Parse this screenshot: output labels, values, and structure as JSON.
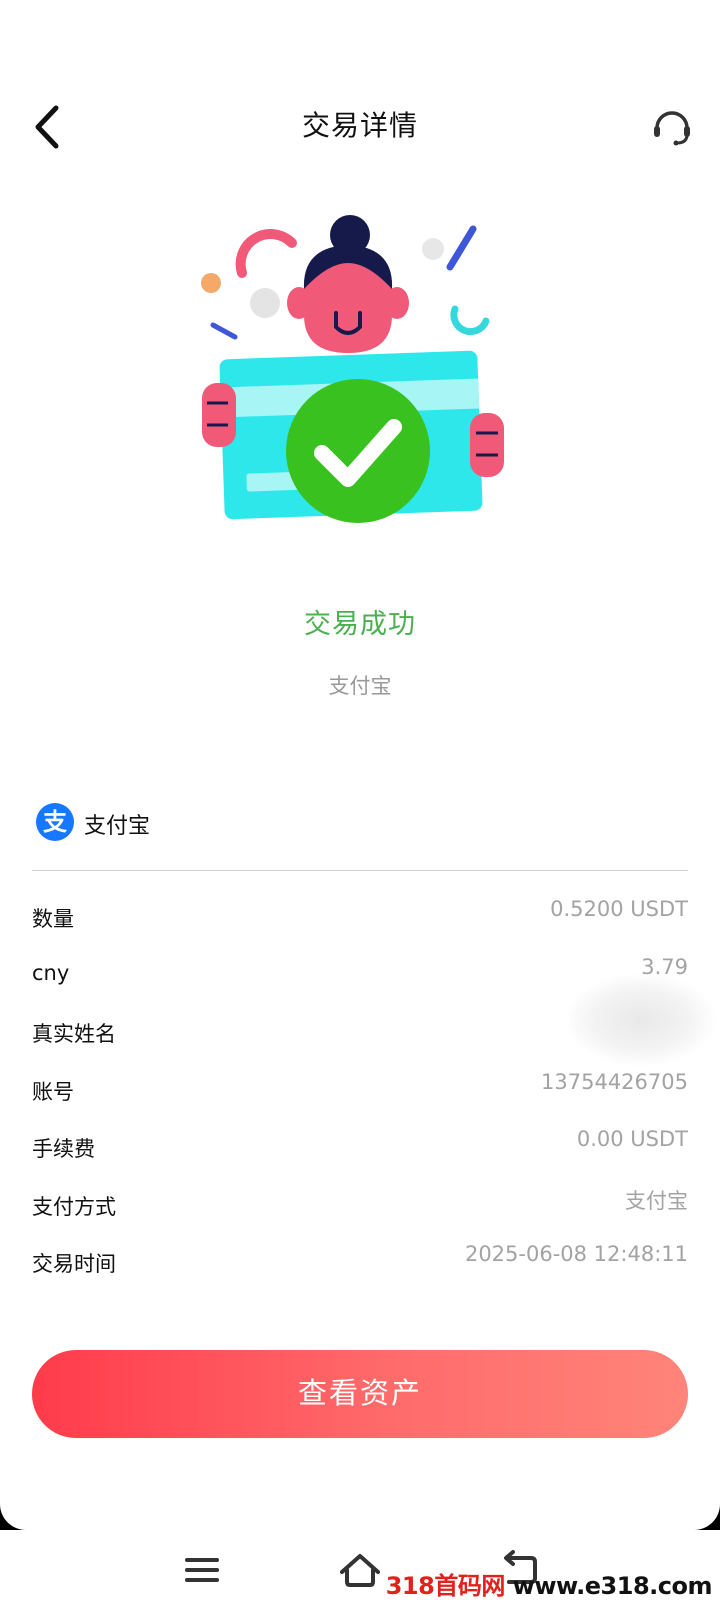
{
  "header": {
    "title": "交易详情",
    "back_icon": "chevron-left-icon",
    "support_icon": "headset-icon"
  },
  "status": {
    "title": "交易成功",
    "subtitle": "支付宝"
  },
  "payment_method": {
    "icon_glyph": "支",
    "label": "支付宝",
    "brand_color": "#1677ff"
  },
  "details": [
    {
      "label": "数量",
      "value": "0.5200 USDT"
    },
    {
      "label": "cny",
      "value": "3.79"
    },
    {
      "label": "真实姓名",
      "value": ""
    },
    {
      "label": "账号",
      "value": "13754426705"
    },
    {
      "label": "手续费",
      "value": "0.00 USDT"
    },
    {
      "label": "支付方式",
      "value": "支付宝"
    },
    {
      "label": "交易时间",
      "value": "2025-06-08 12:48:11"
    }
  ],
  "primary_button": {
    "label": "查看资产"
  },
  "colors": {
    "success": "#4caf50",
    "accent_start": "#ff3b4a",
    "accent_end": "#ff8479"
  },
  "nav_bar": {
    "menu_icon": "menu-icon",
    "home_icon": "home-icon",
    "back_icon": "back-icon"
  },
  "watermark": {
    "red_part": "318首码网",
    "black_part": " www.e318.com"
  }
}
